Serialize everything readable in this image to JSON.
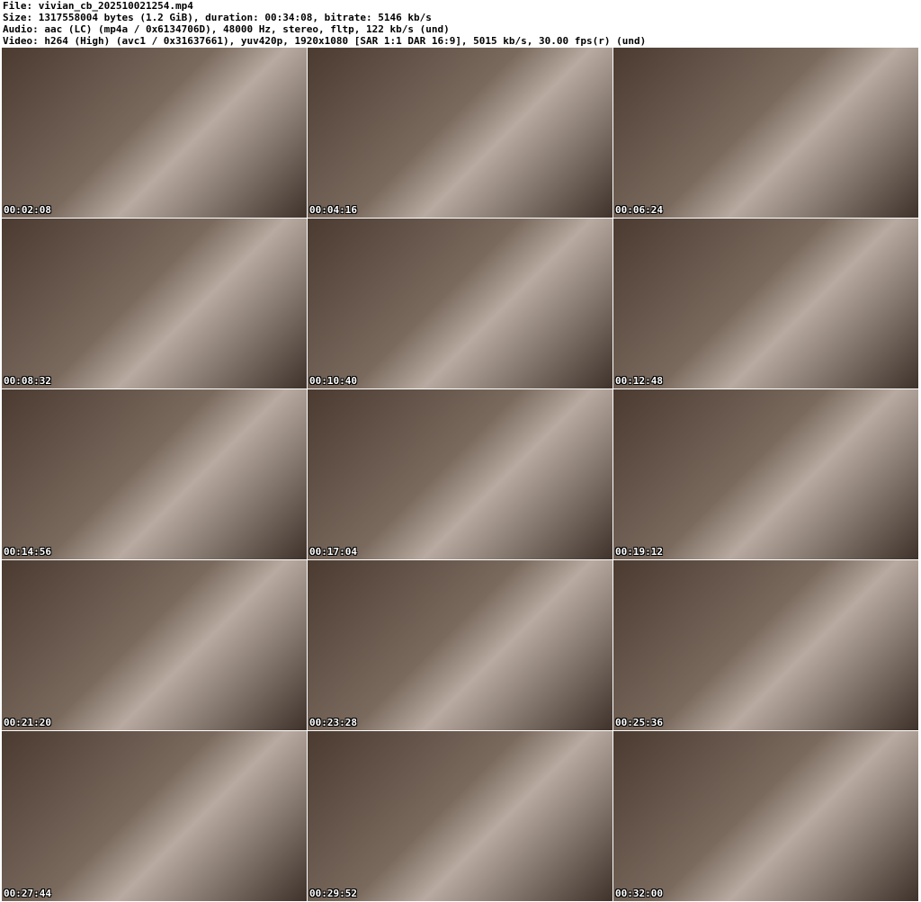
{
  "header": {
    "file": "File: vivian_cb_202510021254.mp4",
    "size": "Size: 1317558004 bytes (1.2 GiB), duration: 00:34:08, bitrate: 5146 kb/s",
    "audio": "Audio: aac (LC) (mp4a / 0x6134706D), 48000 Hz, stereo, fltp, 122 kb/s (und)",
    "video": "Video: h264 (High) (avc1 / 0x31637661), yuv420p, 1920x1080 [SAR 1:1 DAR 16:9], 5015 kb/s, 30.00 fps(r) (und)"
  },
  "thumbnails": [
    "00:02:08",
    "00:04:16",
    "00:06:24",
    "00:08:32",
    "00:10:40",
    "00:12:48",
    "00:14:56",
    "00:17:04",
    "00:19:12",
    "00:21:20",
    "00:23:28",
    "00:25:36",
    "00:27:44",
    "00:29:52",
    "00:32:00"
  ]
}
